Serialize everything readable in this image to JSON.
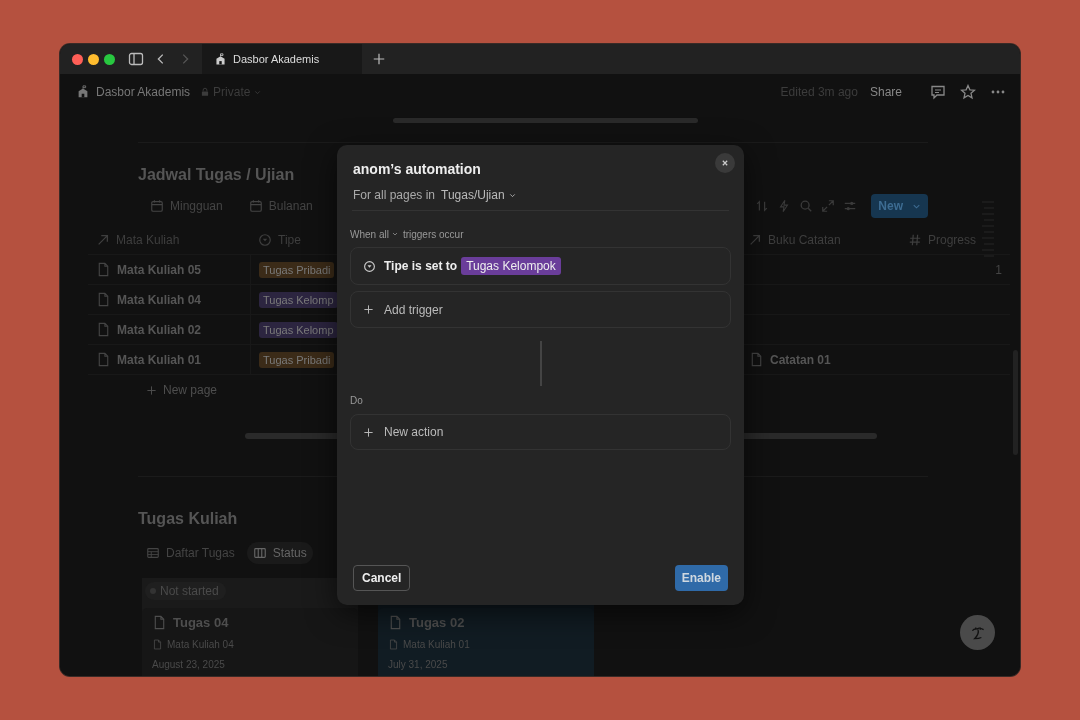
{
  "window": {
    "tab_title": "Dasbor Akademis"
  },
  "topbar": {
    "breadcrumb": "Dasbor Akademis",
    "privacy": "Private",
    "edited": "Edited 3m ago",
    "share": "Share"
  },
  "schedule": {
    "title": "Jadwal Tugas / Ujian",
    "views": [
      {
        "label": "Mingguan",
        "selected": false
      },
      {
        "label": "Bulanan",
        "selected": false
      }
    ],
    "new_button": "New",
    "columns": [
      {
        "label": "Mata Kuliah"
      },
      {
        "label": "Tipe"
      },
      {
        "label": "Buku Catatan"
      },
      {
        "label": "Progress"
      }
    ],
    "rows": [
      {
        "name": "Mata Kuliah 05",
        "type": {
          "label": "Tugas Pribadi",
          "color": "#3b2b18"
        },
        "progress": "1"
      },
      {
        "name": "Mata Kuliah 04",
        "type": {
          "label": "Tugas Kelomp",
          "color": "#2c2540"
        }
      },
      {
        "name": "Mata Kuliah 02",
        "type": {
          "label": "Tugas Kelomp",
          "color": "#2c2540"
        }
      },
      {
        "name": "Mata Kuliah 01",
        "type": {
          "label": "Tugas Pribadi",
          "color": "#3b2b18"
        },
        "notebook": "Catatan 01"
      }
    ],
    "new_row": "New page"
  },
  "tasks": {
    "title": "Tugas Kuliah",
    "views": [
      {
        "label": "Daftar Tugas",
        "selected": false
      },
      {
        "label": "Status",
        "selected": true
      }
    ],
    "groups": [
      {
        "label": "Not started",
        "color": "#1a1a1a",
        "cards": [
          {
            "title": "Tugas 04",
            "course": "Mata Kuliah 04",
            "date": "August 23, 2025"
          }
        ]
      },
      {
        "color": "#0f1920",
        "cards": [
          {
            "title": "Tugas 02",
            "course": "Mata Kuliah 01",
            "date": "July 31, 2025"
          }
        ]
      }
    ]
  },
  "dialog": {
    "title": "anom’s automation",
    "scope_label": "For all pages in",
    "scope_value": "Tugas/Ujian",
    "when_mode": "When all",
    "when_suffix": "triggers occur",
    "triggers": [
      {
        "condition": "Tipe is set to",
        "value": {
          "label": "Tugas Kelompok",
          "color": "#6a3d9a"
        }
      }
    ],
    "add_trigger": "Add trigger",
    "do_label": "Do",
    "new_action": "New action",
    "cancel": "Cancel",
    "enable": "Enable"
  }
}
